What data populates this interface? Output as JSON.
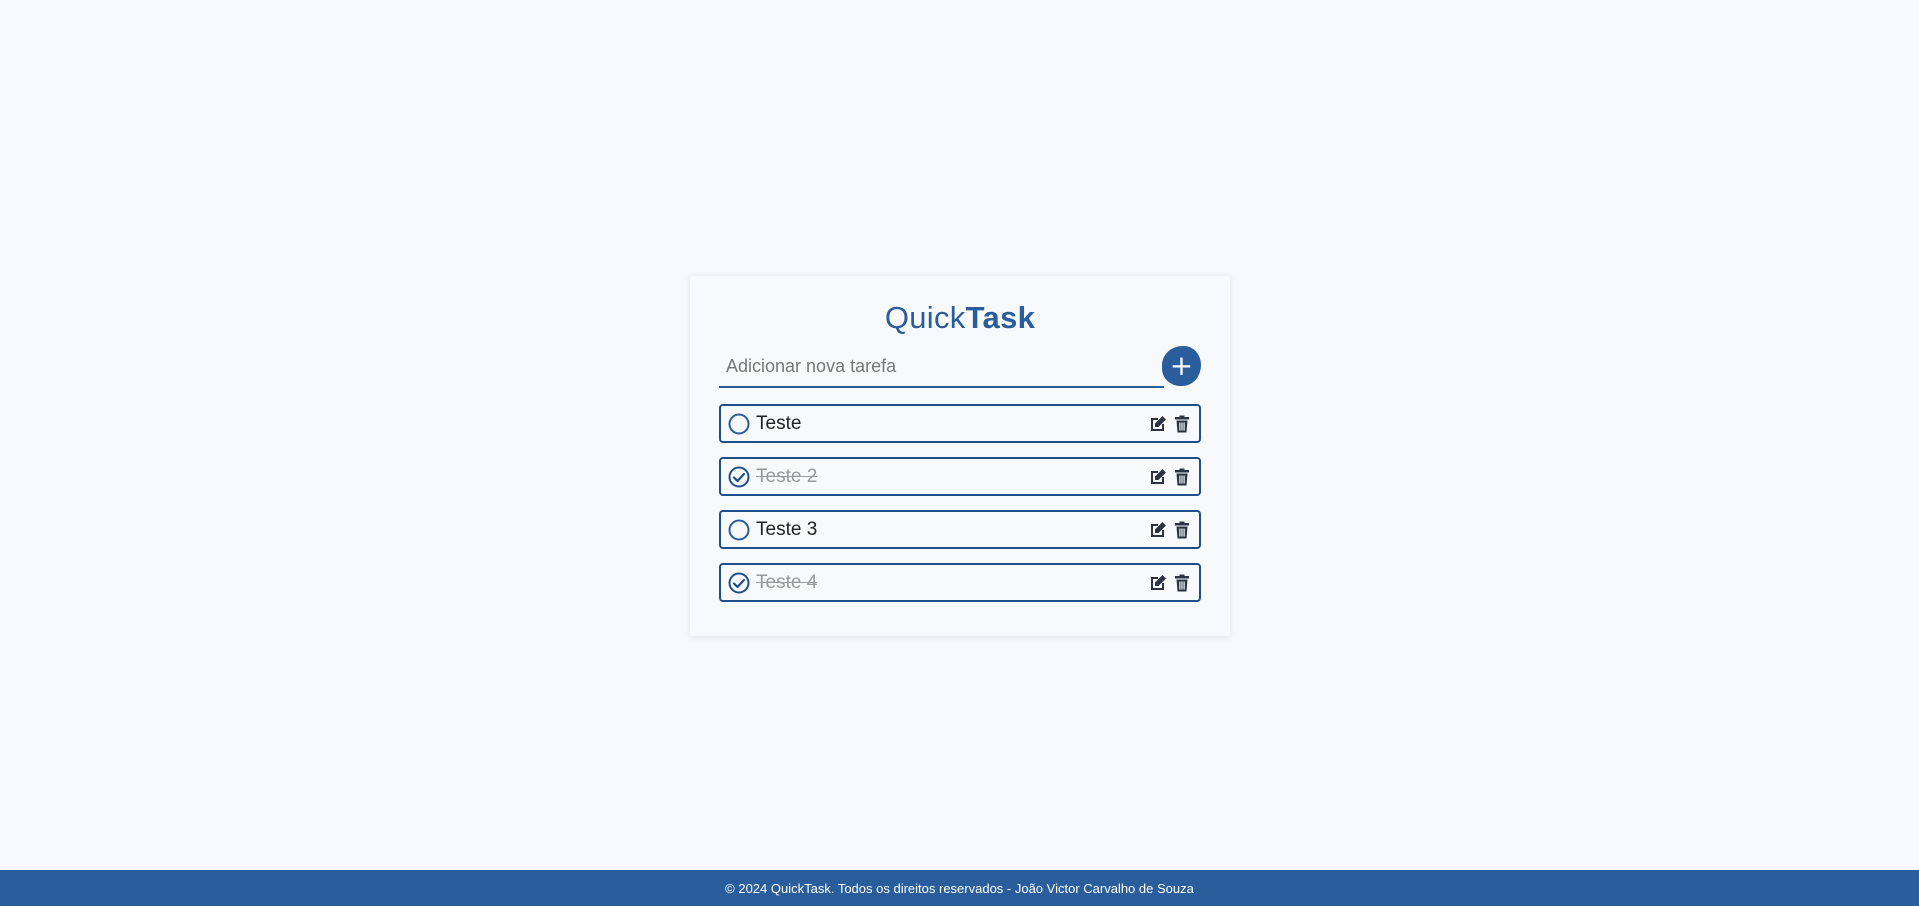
{
  "app": {
    "title_light": "Quick",
    "title_bold": "Task"
  },
  "add_task": {
    "input_value": "",
    "placeholder": "Adicionar nova tarefa",
    "button_label": "+"
  },
  "tasks": [
    {
      "text": "Teste",
      "done": false
    },
    {
      "text": "Teste 2",
      "done": true
    },
    {
      "text": "Teste 3",
      "done": false
    },
    {
      "text": "Teste 4",
      "done": true
    }
  ],
  "icons": {
    "check_empty": "circle-icon",
    "check_done": "check-circle-icon",
    "edit": "edit-icon",
    "delete": "trash-icon"
  },
  "colors": {
    "primary": "#2a5d9b",
    "border": "#1f4f8a",
    "icon": "#2b3440",
    "done_text": "#999999",
    "background": "#f7f9fc"
  },
  "footer": {
    "text": "© 2024 QuickTask. Todos os direitos reservados - João Victor Carvalho de Souza"
  }
}
